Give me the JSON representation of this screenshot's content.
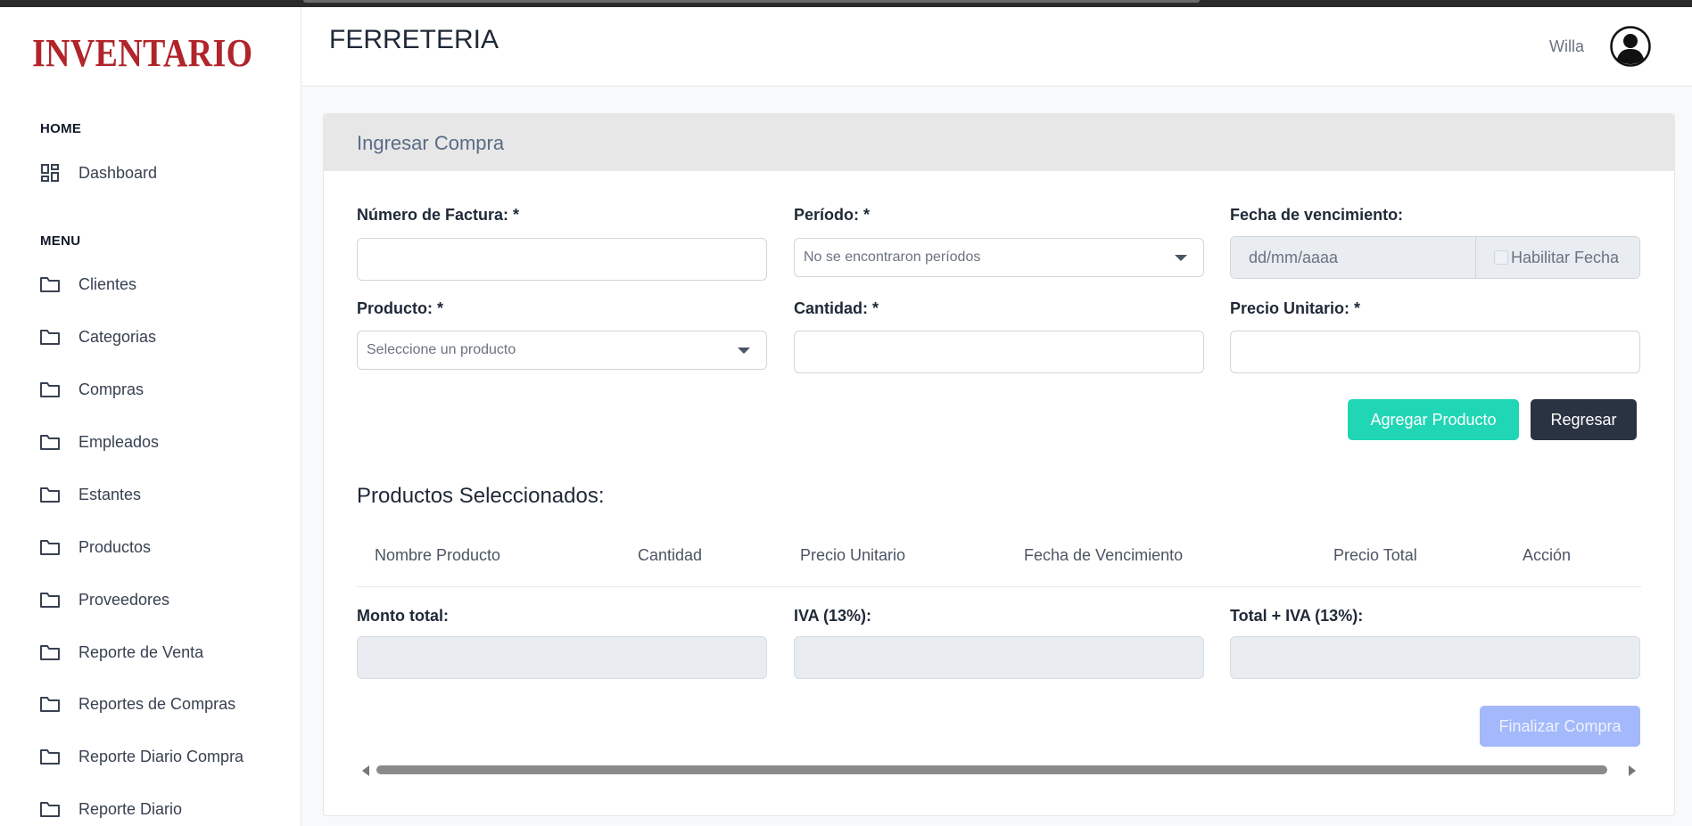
{
  "app": {
    "logo_text": "INVENTARIO"
  },
  "sidebar": {
    "home_label": "HOME",
    "dashboard": {
      "label": "Dashboard",
      "icon": "dashboard-icon"
    },
    "menu_label": "MENU",
    "items": [
      {
        "label": "Clientes",
        "icon": "folder-icon"
      },
      {
        "label": "Categorias",
        "icon": "folder-icon"
      },
      {
        "label": "Compras",
        "icon": "folder-icon"
      },
      {
        "label": "Empleados",
        "icon": "folder-icon"
      },
      {
        "label": "Estantes",
        "icon": "folder-icon"
      },
      {
        "label": "Productos",
        "icon": "folder-icon"
      },
      {
        "label": "Proveedores",
        "icon": "folder-icon"
      },
      {
        "label": "Reporte de Venta",
        "icon": "folder-icon"
      },
      {
        "label": "Reportes de Compras",
        "icon": "folder-icon"
      },
      {
        "label": "Reporte Diario Compra",
        "icon": "folder-icon"
      },
      {
        "label": "Reporte Diario",
        "icon": "folder-icon"
      }
    ]
  },
  "header": {
    "title": "FERRETERIA",
    "user_name": "Willa"
  },
  "form": {
    "card_title": "Ingresar Compra",
    "invoice": {
      "label": "Número de Factura: *",
      "value": ""
    },
    "period": {
      "label": "Período: *",
      "selected": "No se encontraron períodos"
    },
    "expiry": {
      "label": "Fecha de vencimiento:",
      "placeholder": "dd/mm/aaaa",
      "toggle_label": "Habilitar Fecha"
    },
    "product": {
      "label": "Producto: *",
      "selected": "Seleccione un producto"
    },
    "quantity": {
      "label": "Cantidad: *",
      "value": ""
    },
    "unit_price": {
      "label": "Precio Unitario: *",
      "value": ""
    },
    "add_button": "Agregar Producto",
    "back_button": "Regresar"
  },
  "selected_products": {
    "title": "Productos Seleccionados:",
    "columns": [
      "Nombre Producto",
      "Cantidad",
      "Precio Unitario",
      "Fecha de Vencimiento",
      "Precio Total",
      "Acción"
    ],
    "rows": []
  },
  "totals": {
    "amount_label": "Monto total:",
    "iva_label": "IVA (13%):",
    "total_label": "Total + IVA (13%):",
    "amount": "",
    "iva": "",
    "total": ""
  },
  "finish_button": "Finalizar Compra",
  "colors": {
    "brand": "#b0242a",
    "accent_teal": "#20d6b5",
    "dark_button": "#2a3342",
    "disabled_button": "#a4b9fb"
  }
}
